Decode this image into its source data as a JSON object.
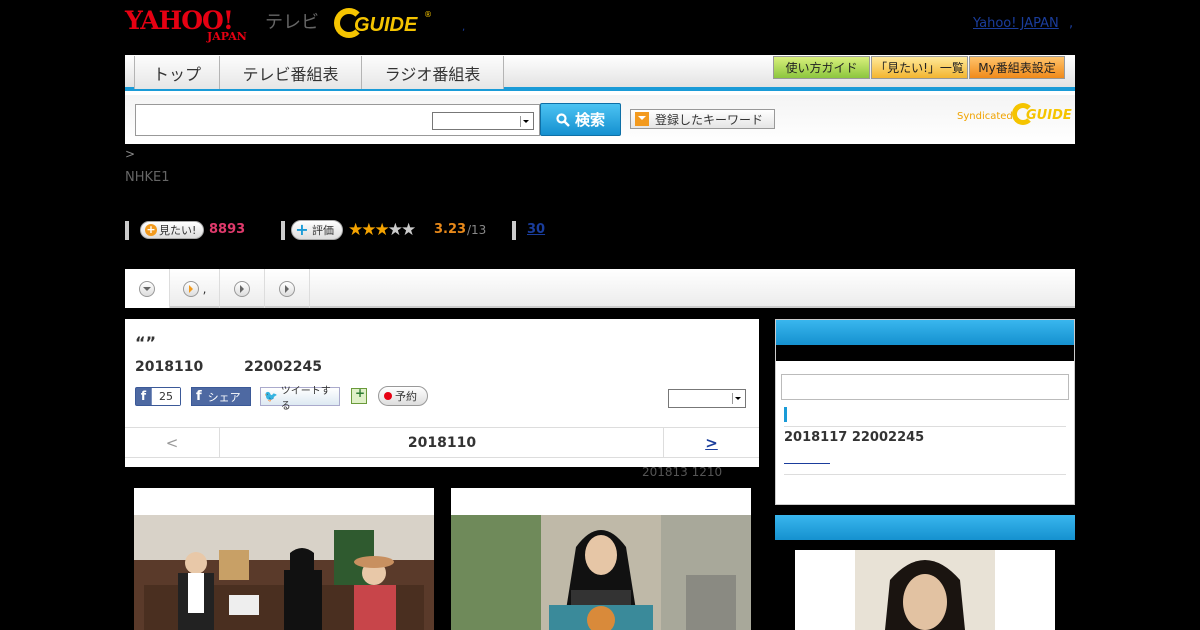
{
  "header": {
    "yahoo_logo": "YAHOO!",
    "yahoo_sub": "JAPAN",
    "tv_label": "テレビ",
    "gguide_logo": "GUIDE",
    "gguide_reg": "®",
    "sep_dot": ",",
    "yahoo_japan_link": "Yahoo! JAPAN",
    "link_sep": ","
  },
  "nav": {
    "tabs": [
      {
        "label": "トップ"
      },
      {
        "label": "テレビ番組表"
      },
      {
        "label": "ラジオ番組表"
      }
    ],
    "buttons": [
      {
        "label": "使い方ガイド"
      },
      {
        "label": "「見たい!」一覧"
      },
      {
        "label": "My番組表設定"
      }
    ],
    "search_button": "検索",
    "keyword_button": "登録したキーワード",
    "syndicated": "Syndicated",
    "syn_logo": "GUIDE"
  },
  "breadcrumb": ">",
  "channel": "NHKE1",
  "stats": {
    "mitai_label": "見たい!",
    "mitai_count": "8893",
    "hyoka_label": "評価",
    "rating": "3.23",
    "rating_den": "/13",
    "stars_on": 3,
    "stars_total": 5,
    "review_count": "30"
  },
  "subtabs": {
    "s2_text": ","
  },
  "program": {
    "title": "“”",
    "date": "2018110",
    "time": "22002245",
    "fb_like_count": "25",
    "fb_share": "シェア",
    "tweet": "ツイートする",
    "reserve": "予約",
    "nav_prev": "<",
    "nav_date": "2018110",
    "nav_next": ">"
  },
  "updated": "201813  1210",
  "sidebar": {
    "date_time": "2018117  22002245"
  },
  "colors": {
    "accent_blue": "#1a9bd7",
    "yahoo_red": "#e60012",
    "gguide_yellow": "#f5c400",
    "mitai_pink": "#e03a6c",
    "rating_orange": "#e8891a"
  }
}
